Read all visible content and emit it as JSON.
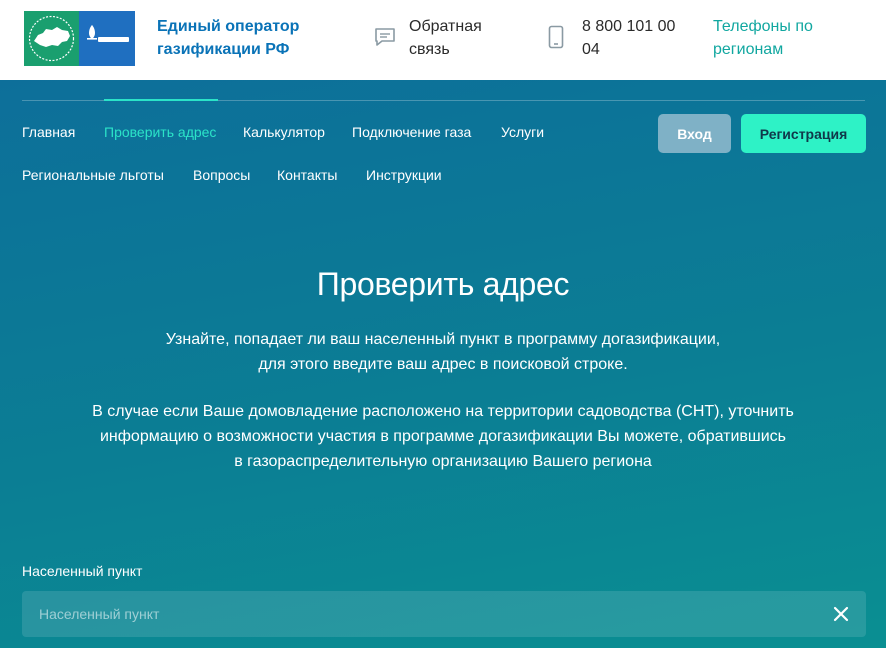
{
  "header": {
    "org_name": "Единый оператор газификации РФ",
    "feedback_label": "Обратная связь",
    "phone_number": "8 800 101 00 04",
    "regions_link": "Телефоны по регионам",
    "icons": {
      "logo_left": "russia-map-logo-icon",
      "logo_right": "gazprom-logo-icon",
      "feedback": "chat-bubble-icon",
      "phone": "mobile-phone-icon"
    },
    "colors": {
      "org_name": "#0a73b7",
      "regions_link": "#11a7a0",
      "logo_green": "#1a9f6f",
      "logo_blue": "#1f6fc0"
    }
  },
  "nav": {
    "items": [
      {
        "label": "Главная",
        "active": false
      },
      {
        "label": "Проверить адрес",
        "active": true
      },
      {
        "label": "Калькулятор",
        "active": false
      },
      {
        "label": "Подключение газа",
        "active": false
      },
      {
        "label": "Услуги",
        "active": false
      },
      {
        "label": "Региональные льготы",
        "active": false
      },
      {
        "label": "Вопросы",
        "active": false
      },
      {
        "label": "Контакты",
        "active": false
      },
      {
        "label": "Инструкции",
        "active": false
      }
    ],
    "login_label": "Вход",
    "register_label": "Регистрация",
    "colors": {
      "active": "#2be3c8",
      "login_bg": "#7fb1c6",
      "register_bg": "#2ef2c6"
    }
  },
  "main": {
    "title": "Проверить адрес",
    "intro_line1": "Узнайте, попадает ли ваш населенный пункт в программу догазификации,",
    "intro_line2": "для этого введите ваш адрес в поисковой строке.",
    "snt_line1": "В случае если Ваше домовладение расположено на территории садоводства (СНТ), уточнить",
    "snt_line2": "информацию о возможности участия в программе догазификации Вы можете, обратившись",
    "snt_line3": "в газораспределительную организацию Вашего региона",
    "field_label": "Населенный пункт",
    "search": {
      "value": "",
      "placeholder": "Населенный пункт",
      "clear_icon": "close-icon"
    },
    "colors": {
      "background_top": "#0d6f9a",
      "background_bottom": "#0a8f92"
    }
  }
}
